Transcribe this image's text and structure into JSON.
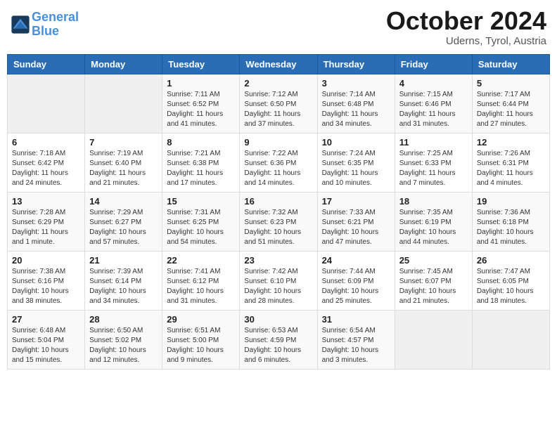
{
  "header": {
    "logo_line1": "General",
    "logo_line2": "Blue",
    "month": "October 2024",
    "location": "Uderns, Tyrol, Austria"
  },
  "weekdays": [
    "Sunday",
    "Monday",
    "Tuesday",
    "Wednesday",
    "Thursday",
    "Friday",
    "Saturday"
  ],
  "weeks": [
    [
      {
        "day": "",
        "info": ""
      },
      {
        "day": "",
        "info": ""
      },
      {
        "day": "1",
        "info": "Sunrise: 7:11 AM\nSunset: 6:52 PM\nDaylight: 11 hours and 41 minutes."
      },
      {
        "day": "2",
        "info": "Sunrise: 7:12 AM\nSunset: 6:50 PM\nDaylight: 11 hours and 37 minutes."
      },
      {
        "day": "3",
        "info": "Sunrise: 7:14 AM\nSunset: 6:48 PM\nDaylight: 11 hours and 34 minutes."
      },
      {
        "day": "4",
        "info": "Sunrise: 7:15 AM\nSunset: 6:46 PM\nDaylight: 11 hours and 31 minutes."
      },
      {
        "day": "5",
        "info": "Sunrise: 7:17 AM\nSunset: 6:44 PM\nDaylight: 11 hours and 27 minutes."
      }
    ],
    [
      {
        "day": "6",
        "info": "Sunrise: 7:18 AM\nSunset: 6:42 PM\nDaylight: 11 hours and 24 minutes."
      },
      {
        "day": "7",
        "info": "Sunrise: 7:19 AM\nSunset: 6:40 PM\nDaylight: 11 hours and 21 minutes."
      },
      {
        "day": "8",
        "info": "Sunrise: 7:21 AM\nSunset: 6:38 PM\nDaylight: 11 hours and 17 minutes."
      },
      {
        "day": "9",
        "info": "Sunrise: 7:22 AM\nSunset: 6:36 PM\nDaylight: 11 hours and 14 minutes."
      },
      {
        "day": "10",
        "info": "Sunrise: 7:24 AM\nSunset: 6:35 PM\nDaylight: 11 hours and 10 minutes."
      },
      {
        "day": "11",
        "info": "Sunrise: 7:25 AM\nSunset: 6:33 PM\nDaylight: 11 hours and 7 minutes."
      },
      {
        "day": "12",
        "info": "Sunrise: 7:26 AM\nSunset: 6:31 PM\nDaylight: 11 hours and 4 minutes."
      }
    ],
    [
      {
        "day": "13",
        "info": "Sunrise: 7:28 AM\nSunset: 6:29 PM\nDaylight: 11 hours and 1 minute."
      },
      {
        "day": "14",
        "info": "Sunrise: 7:29 AM\nSunset: 6:27 PM\nDaylight: 10 hours and 57 minutes."
      },
      {
        "day": "15",
        "info": "Sunrise: 7:31 AM\nSunset: 6:25 PM\nDaylight: 10 hours and 54 minutes."
      },
      {
        "day": "16",
        "info": "Sunrise: 7:32 AM\nSunset: 6:23 PM\nDaylight: 10 hours and 51 minutes."
      },
      {
        "day": "17",
        "info": "Sunrise: 7:33 AM\nSunset: 6:21 PM\nDaylight: 10 hours and 47 minutes."
      },
      {
        "day": "18",
        "info": "Sunrise: 7:35 AM\nSunset: 6:19 PM\nDaylight: 10 hours and 44 minutes."
      },
      {
        "day": "19",
        "info": "Sunrise: 7:36 AM\nSunset: 6:18 PM\nDaylight: 10 hours and 41 minutes."
      }
    ],
    [
      {
        "day": "20",
        "info": "Sunrise: 7:38 AM\nSunset: 6:16 PM\nDaylight: 10 hours and 38 minutes."
      },
      {
        "day": "21",
        "info": "Sunrise: 7:39 AM\nSunset: 6:14 PM\nDaylight: 10 hours and 34 minutes."
      },
      {
        "day": "22",
        "info": "Sunrise: 7:41 AM\nSunset: 6:12 PM\nDaylight: 10 hours and 31 minutes."
      },
      {
        "day": "23",
        "info": "Sunrise: 7:42 AM\nSunset: 6:10 PM\nDaylight: 10 hours and 28 minutes."
      },
      {
        "day": "24",
        "info": "Sunrise: 7:44 AM\nSunset: 6:09 PM\nDaylight: 10 hours and 25 minutes."
      },
      {
        "day": "25",
        "info": "Sunrise: 7:45 AM\nSunset: 6:07 PM\nDaylight: 10 hours and 21 minutes."
      },
      {
        "day": "26",
        "info": "Sunrise: 7:47 AM\nSunset: 6:05 PM\nDaylight: 10 hours and 18 minutes."
      }
    ],
    [
      {
        "day": "27",
        "info": "Sunrise: 6:48 AM\nSunset: 5:04 PM\nDaylight: 10 hours and 15 minutes."
      },
      {
        "day": "28",
        "info": "Sunrise: 6:50 AM\nSunset: 5:02 PM\nDaylight: 10 hours and 12 minutes."
      },
      {
        "day": "29",
        "info": "Sunrise: 6:51 AM\nSunset: 5:00 PM\nDaylight: 10 hours and 9 minutes."
      },
      {
        "day": "30",
        "info": "Sunrise: 6:53 AM\nSunset: 4:59 PM\nDaylight: 10 hours and 6 minutes."
      },
      {
        "day": "31",
        "info": "Sunrise: 6:54 AM\nSunset: 4:57 PM\nDaylight: 10 hours and 3 minutes."
      },
      {
        "day": "",
        "info": ""
      },
      {
        "day": "",
        "info": ""
      }
    ]
  ]
}
